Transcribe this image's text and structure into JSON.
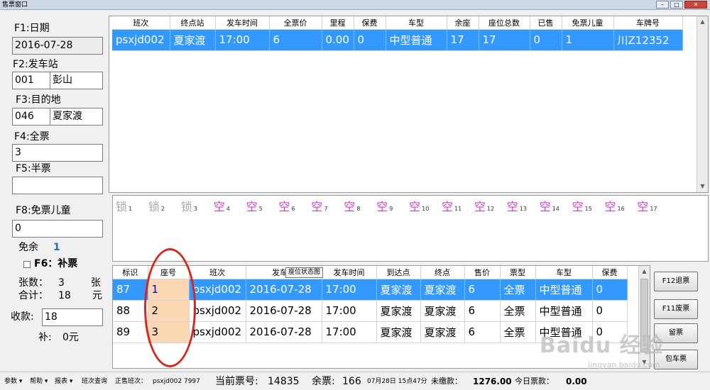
{
  "window": {
    "title": "售票窗口",
    "title_ghost": "",
    "buttons": {
      "minimize": "–",
      "maximize": "□",
      "close": "✕"
    }
  },
  "left": {
    "date_label": "F1:日期",
    "date_value": "2016-07-28",
    "origin_label": "F2:发车站",
    "origin_code": "001",
    "origin_name": "彭山",
    "dest_label": "F3:目的地",
    "dest_code": "046",
    "dest_name": "夏家渡",
    "full_label": "F4:全票",
    "full_value": "3",
    "half_label": "F5:半票",
    "half_value": "",
    "child_label": "F8:免票儿童",
    "child_value": "0",
    "free_left_label": "免余",
    "free_left_value": "1",
    "supplement_label": "F6：补票",
    "count_label": "张数：",
    "count_value": "3",
    "count_unit": "张",
    "total_label": "合计：",
    "total_value": "18",
    "total_unit": "元",
    "received_label": "收款:",
    "received_value": "18",
    "change_label": "补:",
    "change_value": "0元"
  },
  "schedule": {
    "headers": [
      "班次",
      "终点站",
      "发车时间",
      "全票价",
      "里程",
      "保费",
      "车型",
      "余座",
      "座位总数",
      "已售",
      "免票儿童",
      "车牌号"
    ],
    "rows": [
      [
        "psxjd002",
        "夏家渡",
        "17:00",
        "6",
        "0.00",
        "0",
        "中型普通",
        "17",
        "17",
        "0",
        "1",
        "川Z12352"
      ]
    ]
  },
  "seats": [
    {
      "glyph": "锁",
      "num": "1",
      "state": "locked"
    },
    {
      "glyph": "锁",
      "num": "2",
      "state": "locked"
    },
    {
      "glyph": "锁",
      "num": "3",
      "state": "locked"
    },
    {
      "glyph": "空",
      "num": "4",
      "state": "free"
    },
    {
      "glyph": "空",
      "num": "5",
      "state": "free"
    },
    {
      "glyph": "空",
      "num": "6",
      "state": "free"
    },
    {
      "glyph": "空",
      "num": "7",
      "state": "free"
    },
    {
      "glyph": "空",
      "num": "8",
      "state": "free"
    },
    {
      "glyph": "空",
      "num": "9",
      "state": "free"
    },
    {
      "glyph": "空",
      "num": "10",
      "state": "free"
    },
    {
      "glyph": "空",
      "num": "11",
      "state": "free"
    },
    {
      "glyph": "空",
      "num": "12",
      "state": "free"
    },
    {
      "glyph": "空",
      "num": "13",
      "state": "free"
    },
    {
      "glyph": "空",
      "num": "14",
      "state": "free"
    },
    {
      "glyph": "空",
      "num": "15",
      "state": "free"
    },
    {
      "glyph": "空",
      "num": "16",
      "state": "free"
    },
    {
      "glyph": "空",
      "num": "17",
      "state": "free"
    }
  ],
  "tickets": {
    "headers": [
      "标识",
      "座号",
      "班次",
      "发车日",
      "发车时间",
      "到达点",
      "终点",
      "售价",
      "票型",
      "车型",
      "保费"
    ],
    "rows": [
      [
        "87",
        "1",
        "psxjd002",
        "2016-07-28",
        "17:00",
        "夏家渡",
        "夏家渡",
        "6",
        "全票",
        "中型普通",
        "0"
      ],
      [
        "88",
        "2",
        "psxjd002",
        "2016-07-28",
        "17:00",
        "夏家渡",
        "夏家渡",
        "6",
        "全票",
        "中型普通",
        "0"
      ],
      [
        "89",
        "3",
        "psxjd002",
        "2016-07-28",
        "17:00",
        "夏家渡",
        "夏家渡",
        "6",
        "全票",
        "中型普通",
        "0"
      ]
    ],
    "tooltip": "座位状态图"
  },
  "actions": {
    "refund": "F12退票",
    "void": "F11废票",
    "hold": "留票",
    "charter": "包车票"
  },
  "status": {
    "menus": [
      "参数 ▾",
      "帮助 ▾",
      "报表 ▾",
      "班次查询"
    ],
    "selling_label": "正售班次：",
    "selling_value": "psxjd002  7997",
    "ticketno_label": "当前票号:",
    "ticketno_value": "14835",
    "remaining_label": "余票:",
    "remaining_value": "166",
    "datetime": "07月28日 15点47分",
    "unpaid_label": "未缴款：",
    "unpaid_value": "1276.00",
    "today_label": "今日票款：",
    "today_value": "0.00"
  },
  "watermark": {
    "main": "Baidu 经验",
    "sub": "jingyan.baidu.com"
  },
  "colors": {
    "selected_row": "#3399ff",
    "seat_free": "#d13fc9",
    "seat_locked": "#a8a8a8",
    "seat_cell": "#fbd7b3",
    "annotation": "#d9251f"
  }
}
